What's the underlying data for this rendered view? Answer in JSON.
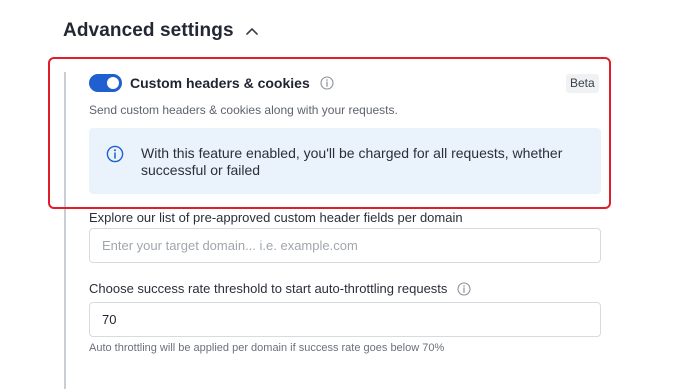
{
  "section": {
    "title": "Advanced settings",
    "chevron_icon": "chevron-up-icon"
  },
  "custom_headers": {
    "toggle_enabled": true,
    "label": "Custom headers & cookies",
    "info_icon": "info-circle-icon",
    "badge": "Beta",
    "helper": "Send custom headers & cookies along with your requests.",
    "notice": {
      "icon": "info-circle-icon",
      "text": "With this feature enabled, you'll be charged for all requests, whether successful or failed"
    }
  },
  "domain_lookup": {
    "label": "Explore our list of pre-approved custom header fields per domain",
    "value": "",
    "placeholder": "Enter your target domain... i.e. example.com"
  },
  "throttling": {
    "label": "Choose success rate threshold to start auto-throttling requests",
    "info_icon": "info-circle-icon",
    "value": "70",
    "caption": "Auto throttling will be applied per domain if success rate goes below 70%"
  },
  "colors": {
    "accent": "#1f5fd0",
    "highlight_border": "#e01e2b",
    "notice_bg": "#eaf2fc"
  }
}
